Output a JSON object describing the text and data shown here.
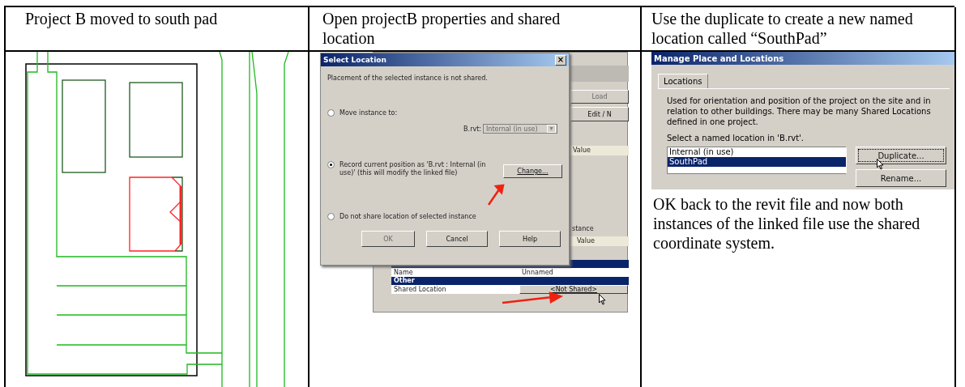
{
  "columns": [
    {
      "heading": "Project B moved to south pad"
    },
    {
      "heading": "Open projectB properties and shared location"
    },
    {
      "heading": "Use the duplicate to create a new named location called “SouthPad”"
    }
  ],
  "select_location_dialog": {
    "title": "Select Location",
    "close": "×",
    "message": "Placement of the selected instance is not shared.",
    "options": [
      {
        "label": "Move instance to:",
        "selected": false
      },
      {
        "label": "Record current position as 'B.rvt : Internal (in use)' (this will modify the linked file)",
        "selected": true
      },
      {
        "label": "Do not share location of selected instance",
        "selected": false
      }
    ],
    "combo_label": "B.rvt:",
    "combo_value": "Internal (in use)",
    "combo_arrow": "▾",
    "change_button": "Change...",
    "buttons": [
      {
        "label": "OK",
        "disabled": true
      },
      {
        "label": "Cancel",
        "disabled": false
      },
      {
        "label": "Help",
        "disabled": false
      }
    ]
  },
  "properties_window": {
    "load_button": "Load",
    "edit_button": "Edit / N",
    "value_header": "Value",
    "group_label": "stance",
    "value_header_2": "Value",
    "name_row": [
      "Name",
      "Unnamed"
    ],
    "category": "Other",
    "property": "Shared Location",
    "property_value": "<Not Shared>"
  },
  "manage_dialog": {
    "title": "Manage Place and Locations",
    "tab": "Locations",
    "description": "Used for orientation and position of the project on the site and in relation to other buildings. There may be many Shared Locations defined in one project.",
    "prompt": "Select a named location in 'B.rvt'.",
    "locations": [
      {
        "name": "Internal (in use)",
        "selected": false
      },
      {
        "name": "SouthPad",
        "selected": true
      }
    ],
    "buttons": [
      "Duplicate...",
      "Rename..."
    ]
  },
  "note": "OK back to the revit file and now both instances of the linked file use the shared coordinate system."
}
